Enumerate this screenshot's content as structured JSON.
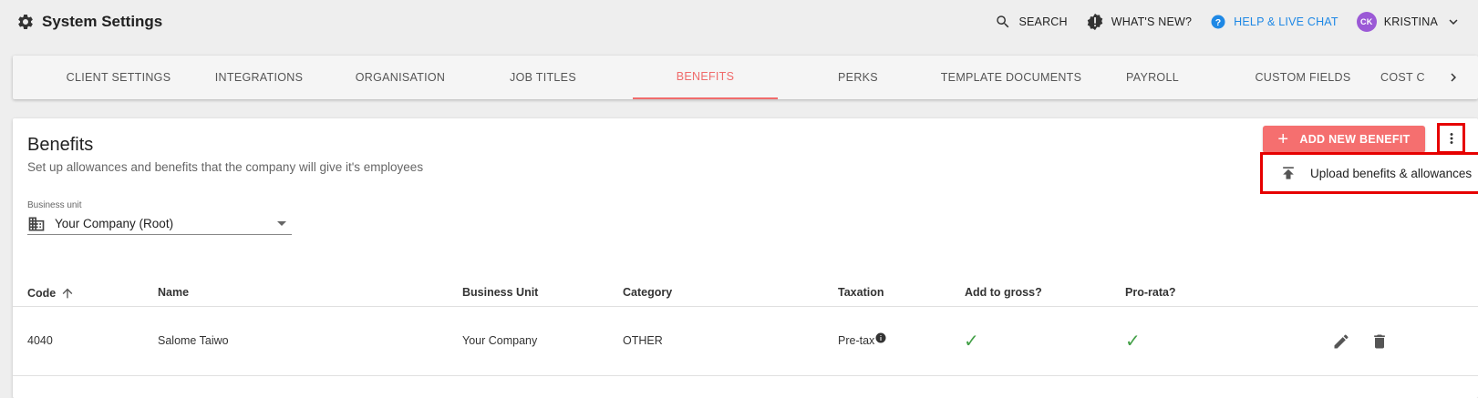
{
  "header": {
    "title": "System Settings",
    "search_label": "SEARCH",
    "whats_new_label": "WHAT'S NEW?",
    "help_label": "HELP & LIVE CHAT",
    "user_initials": "CK",
    "user_name": "KRISTINA"
  },
  "tabs": [
    {
      "label": "CLIENT SETTINGS"
    },
    {
      "label": "INTEGRATIONS"
    },
    {
      "label": "ORGANISATION"
    },
    {
      "label": "JOB TITLES"
    },
    {
      "label": "BENEFITS",
      "active": true
    },
    {
      "label": "PERKS"
    },
    {
      "label": "TEMPLATE DOCUMENTS"
    },
    {
      "label": "PAYROLL"
    },
    {
      "label": "CUSTOM FIELDS"
    },
    {
      "label": "COST C"
    }
  ],
  "page": {
    "title": "Benefits",
    "subtitle": "Set up allowances and benefits that the company will give it's employees",
    "add_button": "ADD NEW BENEFIT",
    "menu_item": "Upload benefits & allowances"
  },
  "filter": {
    "label": "Business unit",
    "value": "Your Company (Root)"
  },
  "table": {
    "columns": [
      "Code",
      "Name",
      "Business Unit",
      "Category",
      "Taxation",
      "Add to gross?",
      "Pro-rata?"
    ],
    "rows": [
      {
        "code": "4040",
        "name": "Salome Taiwo",
        "business_unit": "Your Company",
        "category": "OTHER",
        "taxation": "Pre-tax",
        "add_to_gross": "✓",
        "pro_rata": "✓"
      }
    ]
  },
  "colors": {
    "accent": "#f06b6b",
    "button": "#f56f6f",
    "help_link": "#1e88e5",
    "highlight": "#e60000",
    "check": "#43a047"
  }
}
